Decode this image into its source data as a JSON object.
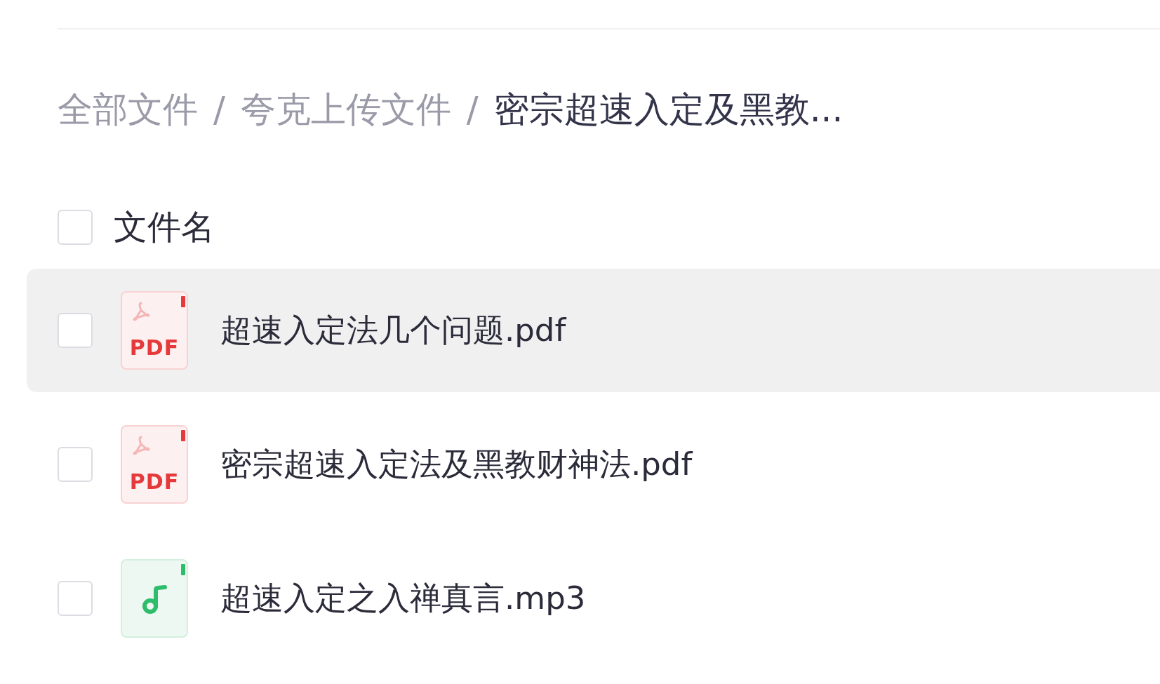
{
  "breadcrumb": [
    {
      "label": "全部文件",
      "current": false
    },
    {
      "label": "夸克上传文件",
      "current": false
    },
    {
      "label": "密宗超速入定及黑教...",
      "current": true
    }
  ],
  "breadcrumb_separator": "/",
  "header": {
    "label": "文件名",
    "checked": false
  },
  "files": [
    {
      "name": "超速入定法几个问题.pdf",
      "kind": "pdf",
      "icon_text": "PDF",
      "checked": false,
      "highlighted": true
    },
    {
      "name": "密宗超速入定法及黑教财神法.pdf",
      "kind": "pdf",
      "icon_text": "PDF",
      "checked": false,
      "highlighted": false
    },
    {
      "name": "超速入定之入禅真言.mp3",
      "kind": "audio",
      "checked": false,
      "highlighted": false
    }
  ]
}
